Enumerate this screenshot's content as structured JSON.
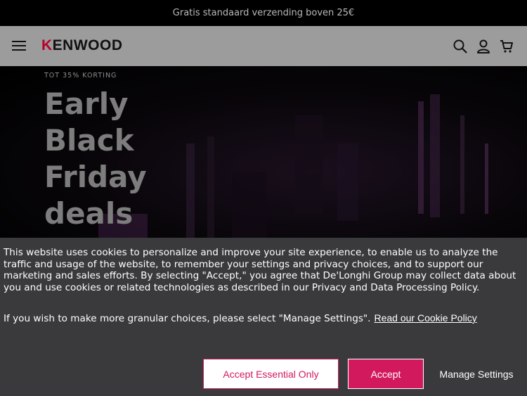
{
  "promo_bar": {
    "text": "Gratis standaard verzending boven 25€"
  },
  "header": {
    "logo_text": "KENWOOD",
    "icons": [
      "menu-icon",
      "search-icon",
      "user-icon",
      "cart-icon"
    ],
    "brand_color": "#b8002b"
  },
  "hero": {
    "eyebrow": "TOT 35% KORTING",
    "title": "Early Black Friday deals"
  },
  "cookie_banner": {
    "text": "This website uses cookies to personalize and improve your site experience, to enable us to analyze the traffic and usage of the website, to remember your settings and privacy choices, and to support our marketing and sales efforts. By selecting \"Accept,\" you agree that De'Longhi Group may collect data about you and use cookies or related technologies as described in our Privacy and Data Processing Policy.",
    "text2": "If you wish to make more granular choices, please select \"Manage Settings\".",
    "link_label": "Read our Cookie Policy",
    "buttons": {
      "essential": "Accept Essential Only",
      "accept": "Accept",
      "manage": "Manage Settings"
    },
    "accent_color": "#d3195d",
    "background": "#3a3a3c"
  }
}
